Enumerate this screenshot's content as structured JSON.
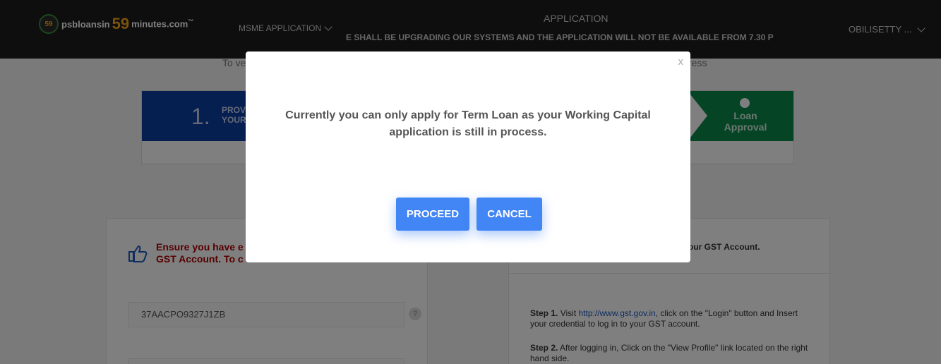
{
  "header": {
    "logo_prefix": "psbloansin",
    "logo_number": "59",
    "logo_suffix": "minutes.com",
    "logo_tm": "™",
    "logo_badge": "59",
    "nav_msme": "MSME APPLICATION",
    "nav_application": "APPLICATION",
    "ticker": "E SHALL BE UPGRADING OUR SYSTEMS AND THE APPLICATION WILL NOT BE AVAILABLE FROM 7.30 P",
    "user_name": "OBILISETTY ..."
  },
  "page": {
    "subtitle_start": "To ve",
    "subtitle_end": "ress",
    "step1_number": "1.",
    "step1_label": "PROV\nYOUR",
    "last_step_label": "Loan Approval",
    "warning_text": "Ensure you have e\nGST Account. To c",
    "gst_value": "37AACPO9327J1ZB",
    "help_glyph": "?",
    "right_card_heading": "our GST Account.",
    "step1_label_text": "Step 1.",
    "step1_text_a": "Visit ",
    "step1_link": "http://www.gst.gov.in",
    "step1_text_b": ", click on the \"Login\" button and Insert your credential to log in to your GST account.",
    "step2_label_text": "Step 2.",
    "step2_text": "After logging in, Click on the \"View Profile\" link located on the right hand side."
  },
  "modal": {
    "close_label": "x",
    "message": "Currently you can only apply for Term Loan as your Working Capital application is still in process.",
    "proceed_label": "PROCEED",
    "cancel_label": "CANCEL"
  },
  "colors": {
    "header_bg": "#1d1d1d",
    "accent_orange": "#f3a51f",
    "step1_blue": "#0d3ea3",
    "approval_green": "#0a8b4c",
    "button_blue": "#4285f4",
    "warning_red": "#b00000"
  }
}
